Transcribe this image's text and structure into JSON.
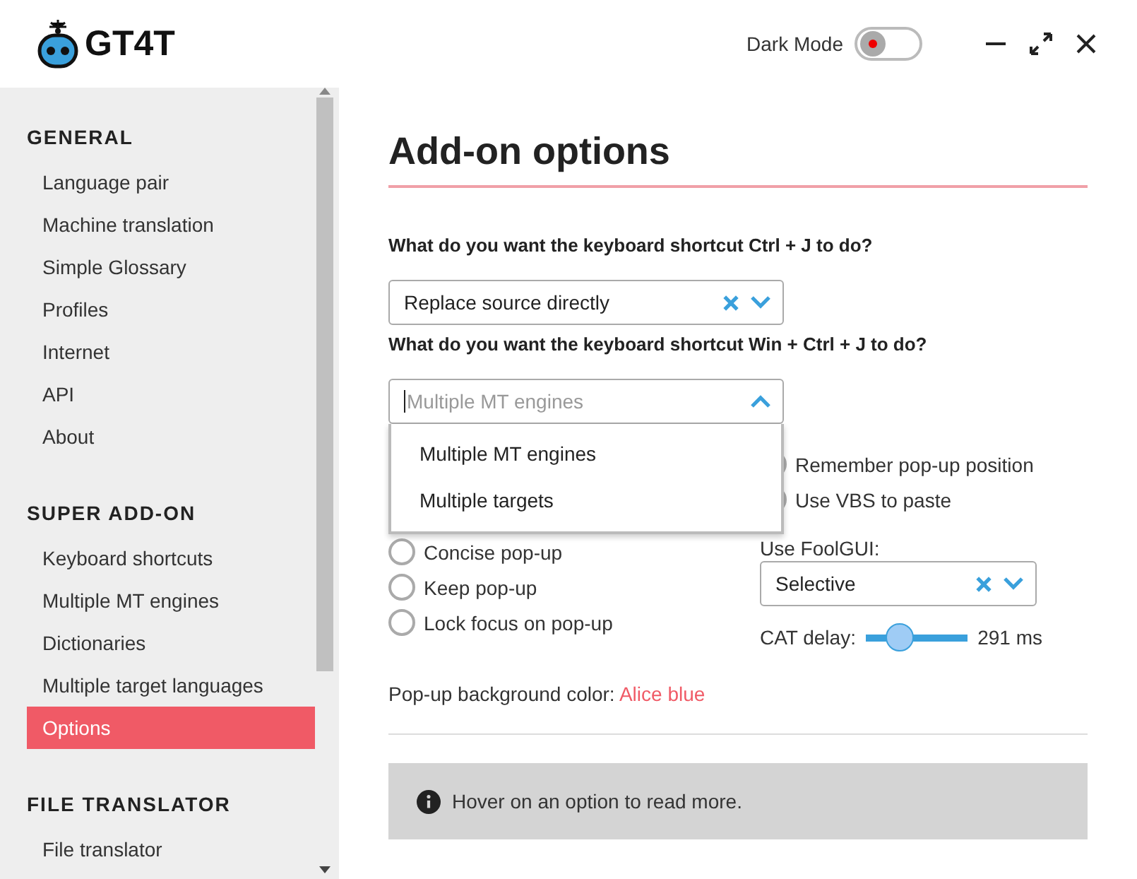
{
  "app": {
    "logo_text": "GT4T",
    "dark_mode": {
      "label": "Dark Mode",
      "on": false
    }
  },
  "sidebar": {
    "sections": [
      {
        "heading": "GENERAL",
        "items": [
          {
            "label": "Language pair",
            "selected": false
          },
          {
            "label": "Machine translation",
            "selected": false
          },
          {
            "label": "Simple Glossary",
            "selected": false
          },
          {
            "label": "Profiles",
            "selected": false
          },
          {
            "label": "Internet",
            "selected": false
          },
          {
            "label": "API",
            "selected": false
          },
          {
            "label": "About",
            "selected": false
          }
        ]
      },
      {
        "heading": "SUPER ADD-ON",
        "items": [
          {
            "label": "Keyboard shortcuts",
            "selected": false
          },
          {
            "label": "Multiple MT engines",
            "selected": false
          },
          {
            "label": "Dictionaries",
            "selected": false
          },
          {
            "label": "Multiple target languages",
            "selected": false
          },
          {
            "label": "Options",
            "selected": true
          }
        ]
      },
      {
        "heading": "FILE TRANSLATOR",
        "items": [
          {
            "label": "File translator",
            "selected": false
          }
        ]
      }
    ]
  },
  "main": {
    "title": "Add-on options",
    "question_1": "What do you want the keyboard shortcut Ctrl + J  to do?",
    "select_1": {
      "value": "Replace source directly"
    },
    "question_2": "What do you want the keyboard shortcut Win + Ctrl + J  to do?",
    "select_2": {
      "placeholder": "Multiple MT engines",
      "expanded": true,
      "options": [
        "Multiple MT engines",
        "Multiple targets"
      ]
    },
    "left_options": [
      {
        "label": "Concise pop-up",
        "checked": false
      },
      {
        "label": "Keep pop-up",
        "checked": false
      },
      {
        "label": "Lock focus on pop-up",
        "checked": false
      }
    ],
    "right_options": [
      {
        "label": "Remember pop-up position",
        "checked": false
      },
      {
        "label": "Use VBS to paste",
        "checked": false
      }
    ],
    "foolgui": {
      "label": "Use FoolGUI:",
      "value": "Selective"
    },
    "cat_delay": {
      "label": "CAT delay:",
      "level": 0.25,
      "reading": "291 ms"
    },
    "bg_color": {
      "label": "Pop-up background color:",
      "value": "Alice blue"
    },
    "info": "Hover on an option to read more."
  }
}
